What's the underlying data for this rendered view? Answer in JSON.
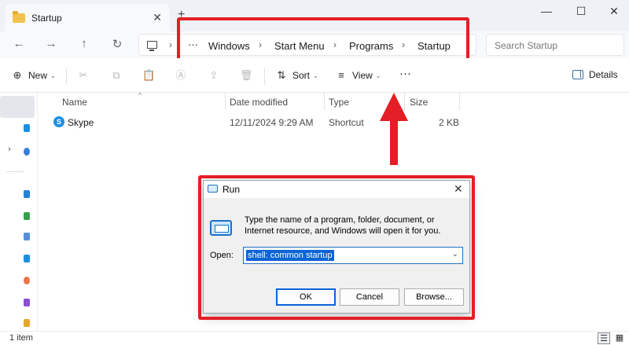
{
  "window": {
    "tab_title": "Startup",
    "tab_close": "✕",
    "new_tab": "+",
    "minimize": "—",
    "maximize": "☐",
    "close": "✕"
  },
  "nav": {
    "back": "←",
    "forward": "→",
    "up": "↑",
    "refresh": "↻"
  },
  "address": {
    "more": "···",
    "chevron": "›",
    "crumbs": [
      "Windows",
      "Start Menu",
      "Programs",
      "Startup"
    ],
    "search_placeholder": "Search Startup"
  },
  "toolbar": {
    "new_label": "New",
    "new_icon": "⊕",
    "sort_label": "Sort",
    "sort_icon": "⇅",
    "view_label": "View",
    "view_icon": "≡",
    "more": "···",
    "details_label": "Details",
    "cut_icon": "✂",
    "copy_icon": "⧉",
    "paste_icon": "📋",
    "rename_icon": "Ⓐ",
    "share_icon": "⇪",
    "delete_icon": "🗑",
    "caret": "⌄"
  },
  "columns": {
    "name": "Name",
    "date_modified": "Date modified",
    "type": "Type",
    "size": "Size",
    "sort_caret": "^"
  },
  "files": [
    {
      "name": "Skype",
      "date_modified": "12/11/2024 9:29 AM",
      "type": "Shortcut",
      "size": "2 KB",
      "icon": "S"
    }
  ],
  "run_dialog": {
    "title": "Run",
    "close": "✕",
    "description": "Type the name of a program, folder, document, or Internet resource, and Windows will open it for you.",
    "open_label": "Open:",
    "open_value": "shell: common startup",
    "combo_caret": "⌄",
    "ok_label": "OK",
    "cancel_label": "Cancel",
    "browse_label": "Browse..."
  },
  "status": {
    "item_count": "1 item",
    "details_view_icon": "☰",
    "tiles_view_icon": "▦"
  },
  "colors": {
    "highlight_red": "#e41e26",
    "selection_blue": "#0a64d6",
    "folder_yellow": "#f2c14e",
    "skype_blue": "#1d8fe1"
  }
}
